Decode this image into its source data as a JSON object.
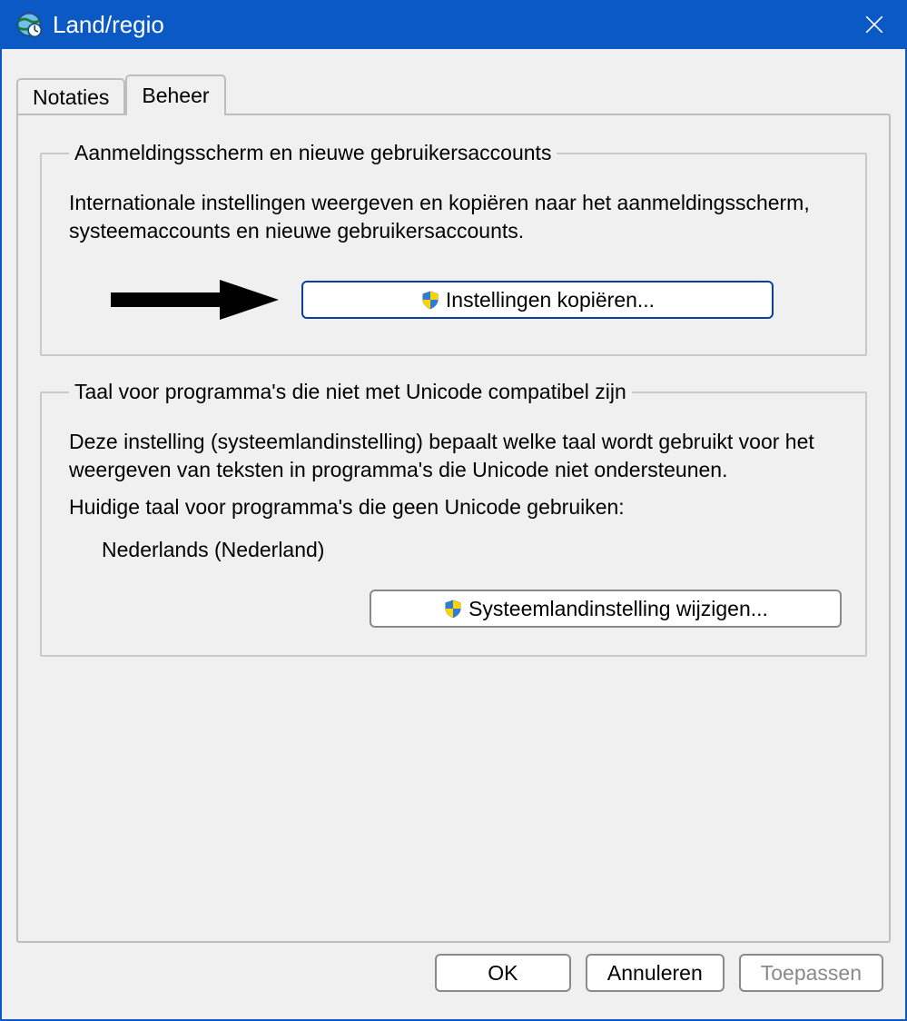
{
  "window": {
    "title": "Land/regio"
  },
  "tabs": [
    {
      "label": "Notaties",
      "active": false
    },
    {
      "label": "Beheer",
      "active": true
    }
  ],
  "group1": {
    "legend": "Aanmeldingsscherm en nieuwe gebruikersaccounts",
    "description": "Internationale instellingen weergeven en kopiëren naar het aanmeldingsscherm, systeemaccounts en nieuwe gebruikersaccounts.",
    "button_label": "Instellingen kopiëren..."
  },
  "group2": {
    "legend": "Taal voor programma's die niet met Unicode compatibel zijn",
    "description": "Deze instelling (systeemlandinstelling) bepaalt welke taal wordt gebruikt voor het weergeven van teksten in programma's die Unicode niet ondersteunen.",
    "current_label": "Huidige taal voor programma's die geen Unicode gebruiken:",
    "current_value": "Nederlands (Nederland)",
    "button_label": "Systeemlandinstelling wijzigen..."
  },
  "footer": {
    "ok": "OK",
    "cancel": "Annuleren",
    "apply": "Toepassen"
  }
}
